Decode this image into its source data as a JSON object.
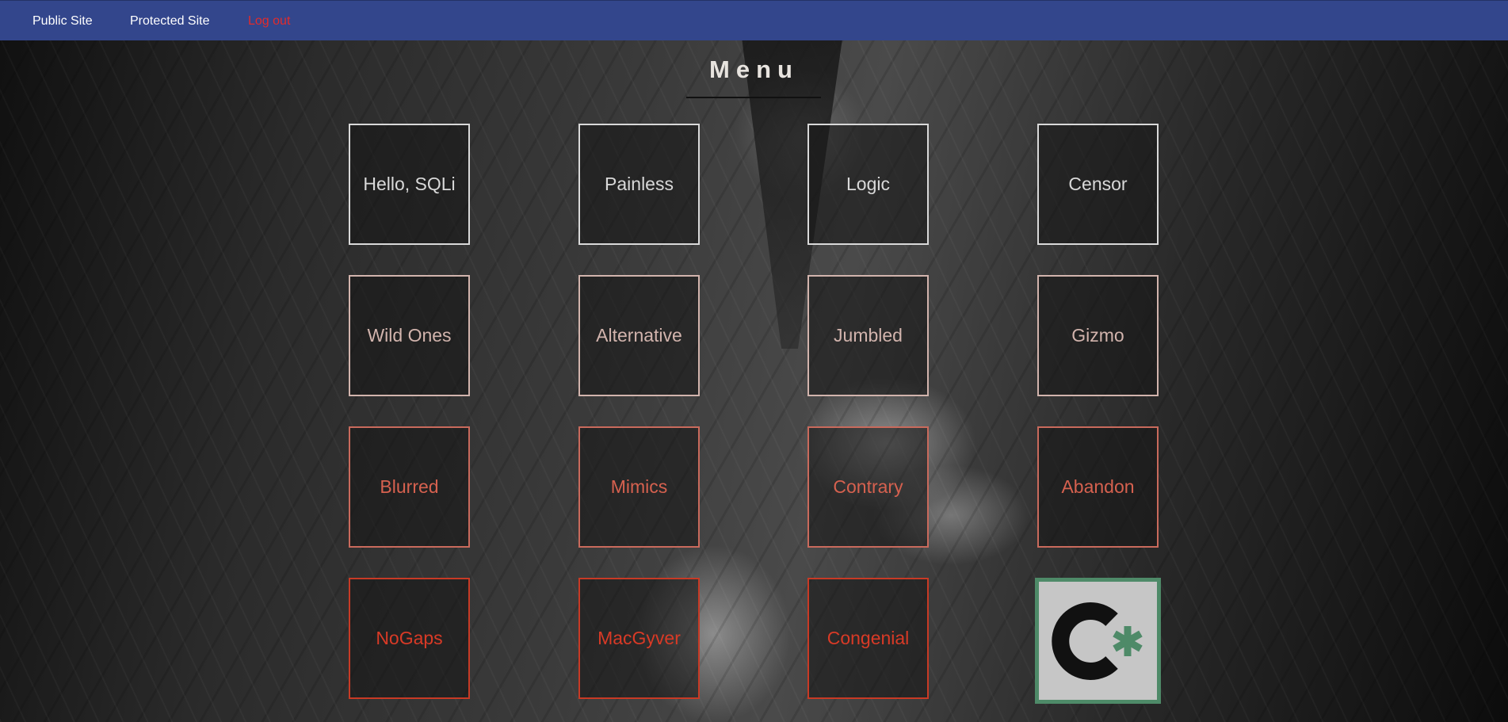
{
  "nav": {
    "public": "Public Site",
    "protected": "Protected Site",
    "logout": "Log out"
  },
  "title": "Menu",
  "tiles": [
    {
      "label": "Hello, SQLi",
      "color": "#d9d9d9",
      "border": "#d9d9d9"
    },
    {
      "label": "Painless",
      "color": "#d9d9d9",
      "border": "#d9d9d9"
    },
    {
      "label": "Logic",
      "color": "#d9d9d9",
      "border": "#d9d9d9"
    },
    {
      "label": "Censor",
      "color": "#d9d9d9",
      "border": "#d9d9d9"
    },
    {
      "label": "Wild Ones",
      "color": "#d2b4ad",
      "border": "#d2b4ad"
    },
    {
      "label": "Alternative",
      "color": "#d2b4ad",
      "border": "#d2b4ad"
    },
    {
      "label": "Jumbled",
      "color": "#d2b4ad",
      "border": "#d2b4ad"
    },
    {
      "label": "Gizmo",
      "color": "#d2b4ad",
      "border": "#d2b4ad"
    },
    {
      "label": "Blurred",
      "color": "#d6614f",
      "border": "#c96a5c"
    },
    {
      "label": "Mimics",
      "color": "#d6614f",
      "border": "#c96a5c"
    },
    {
      "label": "Contrary",
      "color": "#d6614f",
      "border": "#c96a5c"
    },
    {
      "label": "Abandon",
      "color": "#d6614f",
      "border": "#c96a5c"
    },
    {
      "label": "NoGaps",
      "color": "#d93a26",
      "border": "#c83a25"
    },
    {
      "label": "MacGyver",
      "color": "#d93a26",
      "border": "#c83a25"
    },
    {
      "label": "Congenial",
      "color": "#d93a26",
      "border": "#c83a25"
    }
  ],
  "logo": {
    "icon": "c-asterisk-logo",
    "letter_color": "#111111",
    "asterisk_color": "#4e8a68",
    "background": "#c6c6c6",
    "border": "#4e8a68"
  }
}
